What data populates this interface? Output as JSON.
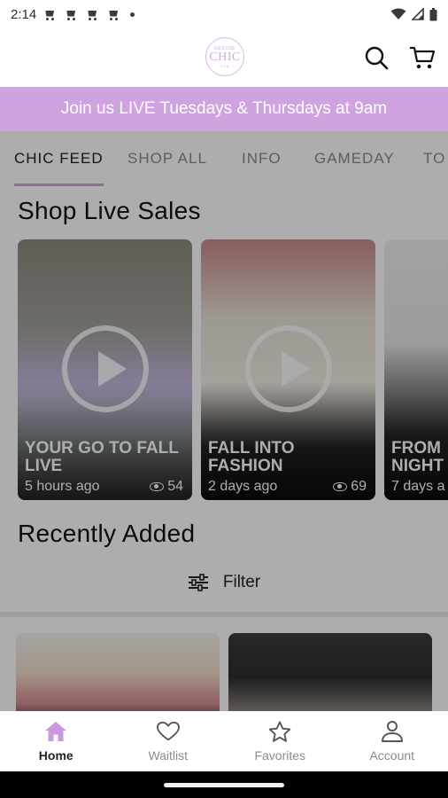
{
  "status_bar": {
    "time": "2:14",
    "notification_icons": [
      "cart-icon",
      "cart-icon",
      "cart-icon",
      "cart-icon"
    ],
    "system_icons": [
      "wifi-icon",
      "signal-icon",
      "battery-icon"
    ]
  },
  "header": {
    "logo": {
      "top": "RESCUE",
      "main": "CHIC",
      "bottom": "LIFE"
    },
    "icons": [
      "search-icon",
      "cart-icon"
    ]
  },
  "banner": {
    "text": "Join us LIVE Tuesdays & Thursdays at 9am",
    "color": "#cfa3e0"
  },
  "tabs": [
    {
      "label": "CHIC FEED",
      "active": true
    },
    {
      "label": "SHOP ALL",
      "active": false
    },
    {
      "label": "INFO",
      "active": false
    },
    {
      "label": "GAMEDAY",
      "active": false
    },
    {
      "label": "TO",
      "active": false
    }
  ],
  "shop_live": {
    "title": "Shop Live Sales",
    "cards": [
      {
        "title": "YOUR GO TO FALL LIVE",
        "time": "5 hours ago",
        "views": "54"
      },
      {
        "title": "FALL INTO FASHION",
        "time": "2 days ago",
        "views": "69"
      },
      {
        "title": "FROM NIGHT",
        "time": "7 days a",
        "views": ""
      }
    ]
  },
  "recently_added": {
    "title": "Recently Added",
    "filter_label": "Filter"
  },
  "bottom_nav": [
    {
      "label": "Home",
      "icon": "home-icon",
      "active": true
    },
    {
      "label": "Waitlist",
      "icon": "heart-icon",
      "active": false
    },
    {
      "label": "Favorites",
      "icon": "star-icon",
      "active": false
    },
    {
      "label": "Account",
      "icon": "account-icon",
      "active": false
    }
  ],
  "accent_color": "#d29fe6"
}
